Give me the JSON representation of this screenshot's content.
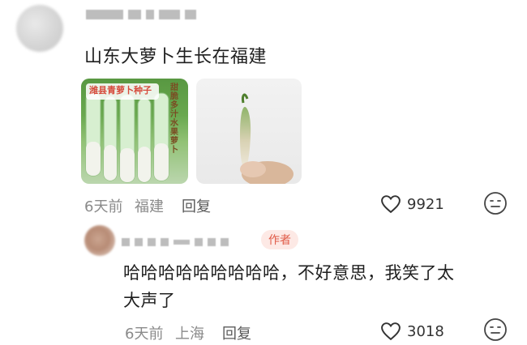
{
  "comment1": {
    "text": "山东大萝卜生长在福建",
    "meta_time": "6天前",
    "meta_location": "福建",
    "reply_label": "回复",
    "like_count": "9921",
    "image1": {
      "label": "潍县青萝卜种子",
      "side_text": "甜脆多汁水果萝卜"
    }
  },
  "comment2": {
    "author_badge": "作者",
    "text_line1": "哈哈哈哈哈哈哈哈哈，不好意思，我笑了太",
    "text_line2": "大声了",
    "meta_time": "6天前",
    "meta_location": "上海",
    "reply_label": "回复",
    "like_count": "3018"
  },
  "icons": {
    "like": "heart-outline-icon",
    "more": "neutral-face-icon"
  },
  "colors": {
    "author_badge_bg": "#fde9e5",
    "author_badge_text": "#e05a47"
  }
}
